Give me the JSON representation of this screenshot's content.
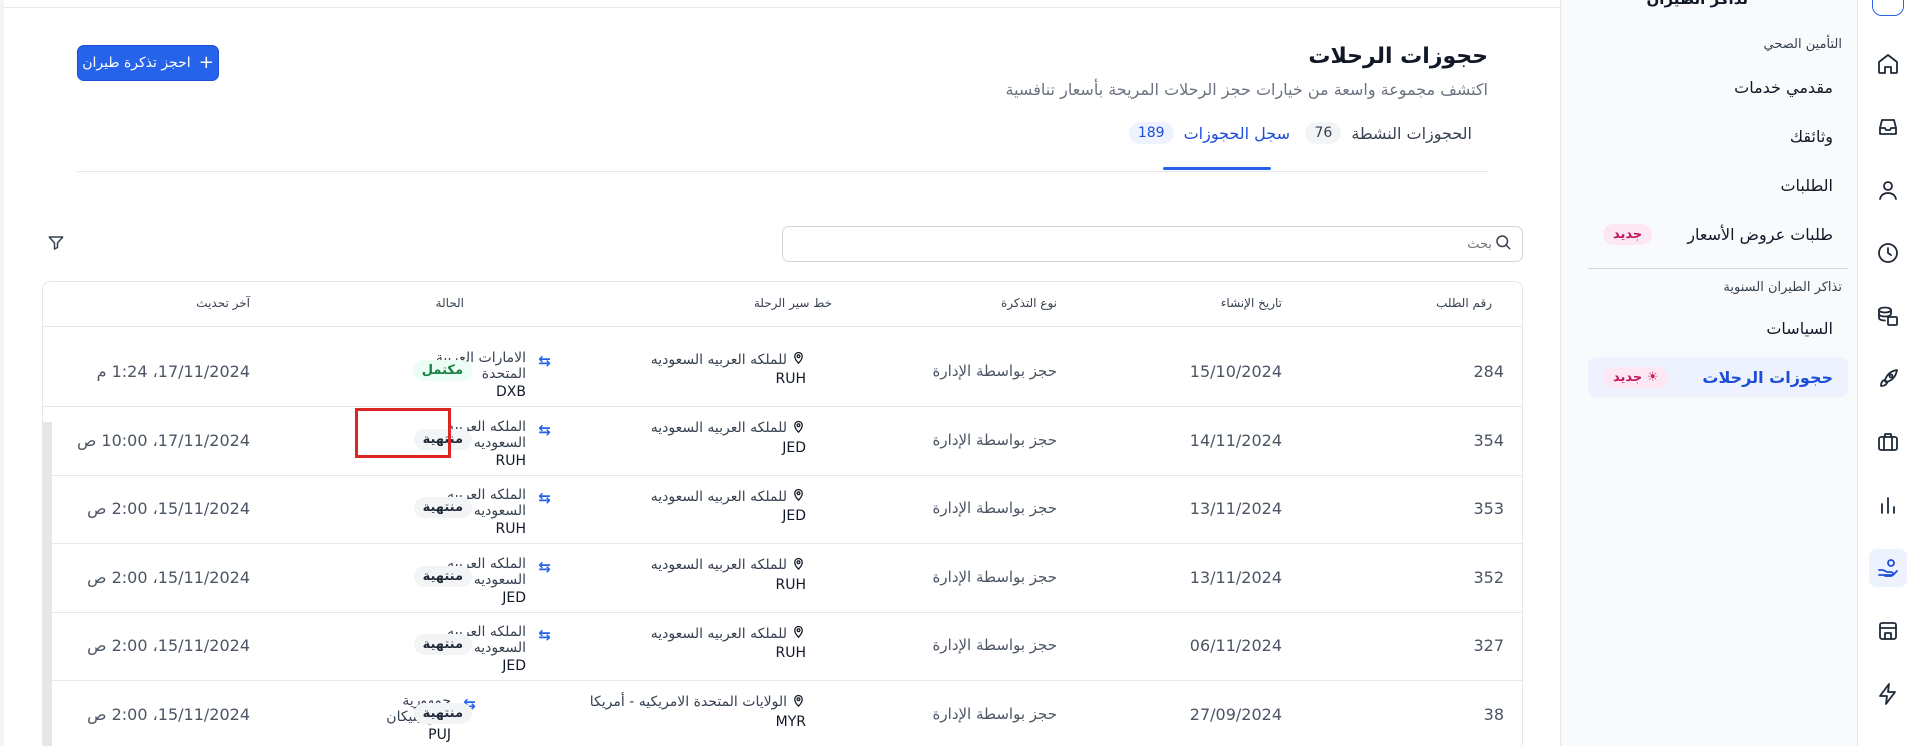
{
  "sidebar": {
    "clipped_title": "تذاكر الطيران",
    "section_health": "التأمين الصحي",
    "items_health": [
      {
        "label": "مقدمي خدمات"
      },
      {
        "label": "وثائقك"
      },
      {
        "label": "الطلبات"
      },
      {
        "label": "طلبات عروض الأسعار",
        "badge": "جديد"
      }
    ],
    "section_flights": "تذاكر الطيران السنوية",
    "items_flights": [
      {
        "label": "السياسات"
      },
      {
        "label": "حجوزات الرحلات",
        "badge": "جديد",
        "badge_icon": "☀"
      }
    ]
  },
  "header": {
    "title": "حجوزات الرحلات",
    "subtitle": "اكتشف مجموعة واسعة من خيارات حجز الرحلات المريحة بأسعار تنافسية",
    "book_button": "احجز تذكرة طيران",
    "book_plus": "+"
  },
  "tabs": [
    {
      "label": "الحجوزات النشطة",
      "count": "76"
    },
    {
      "label": "سجل الحجوزات",
      "count": "189",
      "active": true
    }
  ],
  "search": {
    "placeholder": "بحث"
  },
  "table": {
    "columns": {
      "request_no": "رقم الطلب",
      "created": "تاريخ الإنشاء",
      "ticket_type": "نوع التذكرة",
      "route": "خط سير الرحلة",
      "status": "الحالة",
      "updated": "آخر تحديث"
    },
    "rows": [
      {
        "request_no": "284",
        "created": "15/10/2024",
        "ticket_type": "حجز بواسطة الإدارة",
        "from_city": "للملكه العربيه السعوديه",
        "from_code": "RUH",
        "to_city": "الامارات العربية المتحدة",
        "to_code": "DXB",
        "status": "مكتمل",
        "status_kind": "done",
        "updated": "17/11/2024، 1:24 م"
      },
      {
        "request_no": "354",
        "created": "14/11/2024",
        "ticket_type": "حجز بواسطة الإدارة",
        "from_city": "للملكه العربيه السعوديه",
        "from_code": "JED",
        "to_city": "الملكه العربيه السعوديه",
        "to_code": "RUH",
        "status": "منتهية",
        "status_kind": "ended",
        "updated": "17/11/2024، 10:00 ص"
      },
      {
        "request_no": "353",
        "created": "13/11/2024",
        "ticket_type": "حجز بواسطة الإدارة",
        "from_city": "للملكه العربيه السعوديه",
        "from_code": "JED",
        "to_city": "الملكه العربيه السعوديه",
        "to_code": "RUH",
        "status": "منتهية",
        "status_kind": "ended",
        "updated": "15/11/2024، 2:00 ص"
      },
      {
        "request_no": "352",
        "created": "13/11/2024",
        "ticket_type": "حجز بواسطة الإدارة",
        "from_city": "للملكه العربيه السعوديه",
        "from_code": "RUH",
        "to_city": "الملكه العربيه السعوديه",
        "to_code": "JED",
        "status": "منتهية",
        "status_kind": "ended",
        "updated": "15/11/2024، 2:00 ص"
      },
      {
        "request_no": "327",
        "created": "06/11/2024",
        "ticket_type": "حجز بواسطة الإدارة",
        "from_city": "للملكه العربيه السعوديه",
        "from_code": "RUH",
        "to_city": "الملكه العربيه السعوديه",
        "to_code": "JED",
        "status": "منتهية",
        "status_kind": "ended",
        "updated": "15/11/2024، 2:00 ص"
      },
      {
        "request_no": "38",
        "created": "27/09/2024",
        "ticket_type": "حجز بواسطة الإدارة",
        "from_city": "الولايات المتحدة الامريكيه - أمريكا",
        "from_code": "MYR",
        "to_city": "جمهورية الدومينيكان",
        "to_code": "PUJ",
        "status": "منتهية",
        "status_kind": "ended",
        "updated": "15/11/2024، 2:00 ص"
      }
    ],
    "arrow_glyph": "⇆"
  },
  "rail_icons": [
    "home-icon",
    "inbox-icon",
    "user-icon",
    "clock-icon",
    "coins-icon",
    "rocket-icon",
    "briefcase-icon",
    "chart-icon",
    "hand-coins-icon",
    "store-icon",
    "bolt-icon"
  ],
  "colors": {
    "accent": "#2563eb",
    "done": "#15803d",
    "new_badge": "#be185d",
    "highlight": "#dc2626"
  }
}
